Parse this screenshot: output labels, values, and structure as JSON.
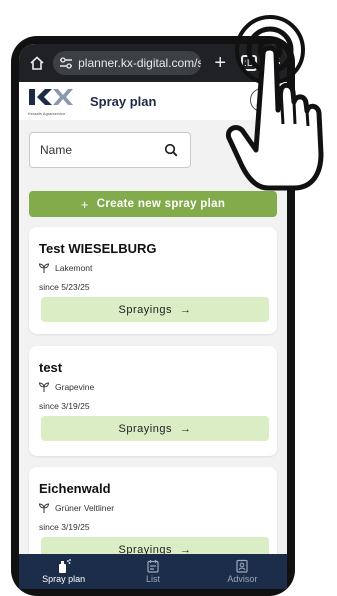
{
  "browser": {
    "url": "planner.kx-digital.com/s|",
    "new_tab_label": "+",
    "tab_count": ":D"
  },
  "header": {
    "logo_text": "Kessels Agrarservice",
    "title": "Spray plan"
  },
  "search": {
    "placeholder": "Name"
  },
  "create_button": {
    "icon": "+",
    "label": "Create new spray plan"
  },
  "plans": [
    {
      "name": "Test WIESELBURG",
      "variety": "Lakemont",
      "since": "since 5/23/25",
      "button_label": "Sprayings",
      "arrow": "→"
    },
    {
      "name": "test",
      "variety": "Grapevine",
      "since": "since 3/19/25",
      "button_label": "Sprayings",
      "arrow": "→"
    },
    {
      "name": "Eichenwald",
      "variety": "Grüner Veltliner",
      "since": "since 3/19/25",
      "button_label": "Sprayings",
      "arrow": "→"
    }
  ],
  "bottom_nav": [
    {
      "label": "Spray plan",
      "icon": "spray-icon",
      "active": true
    },
    {
      "label": "List",
      "icon": "calendar-icon",
      "active": false
    },
    {
      "label": "Advisor",
      "icon": "advisor-icon",
      "active": false
    }
  ],
  "colors": {
    "accent_green": "#82ab4c",
    "light_green": "#dbedc4",
    "nav_navy": "#1c2d4a",
    "title_navy": "#1f2a44"
  }
}
